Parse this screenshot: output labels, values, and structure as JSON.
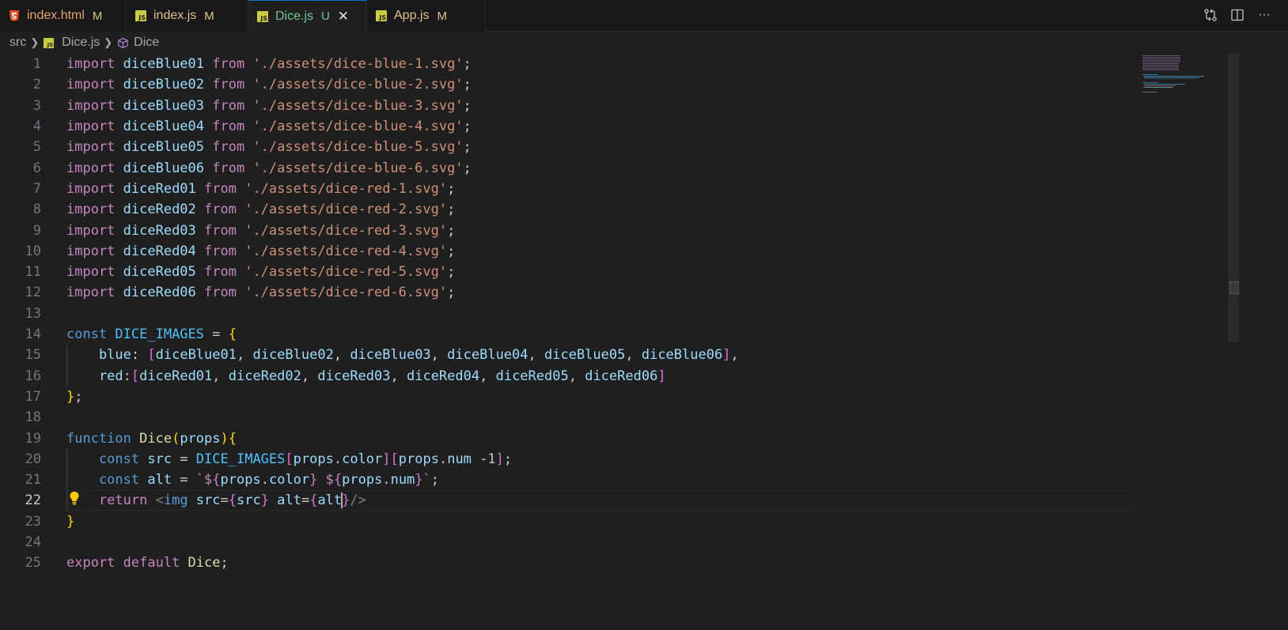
{
  "tabs": [
    {
      "label": "index.html",
      "badge": "M",
      "icon": "html5-icon"
    },
    {
      "label": "index.js",
      "badge": "M",
      "icon": "javascript-file-icon"
    },
    {
      "label": "Dice.js",
      "badge": "U",
      "icon": "javascript-file-icon",
      "active": true
    },
    {
      "label": "App.js",
      "badge": "M",
      "icon": "javascript-file-icon"
    }
  ],
  "tab_close_glyph": "✕",
  "js_icon_text": "JS",
  "actions": [
    "compare-changes-icon",
    "split-editor-icon",
    "more-actions-icon"
  ],
  "more_glyph": "···",
  "breadcrumb": {
    "folder": "src",
    "file": "Dice.js",
    "symbol": "Dice"
  },
  "colors": {
    "accent": "#0078d4",
    "modified": "#e2c08d",
    "untracked": "#73c991",
    "editor_bg": "#1f1f1f"
  },
  "editor": {
    "current_line": 22,
    "line_numbers": [
      "1",
      "2",
      "3",
      "4",
      "5",
      "6",
      "7",
      "8",
      "9",
      "10",
      "11",
      "12",
      "13",
      "14",
      "15",
      "16",
      "17",
      "18",
      "19",
      "20",
      "21",
      "22",
      "23",
      "24",
      "25"
    ],
    "lines": [
      [
        [
          "import ",
          "kw"
        ],
        [
          "diceBlue01",
          "var"
        ],
        [
          " from ",
          "kw"
        ],
        [
          "'./assets/dice-blue-1.svg'",
          "str"
        ],
        [
          ";",
          "pun"
        ]
      ],
      [
        [
          "import ",
          "kw"
        ],
        [
          "diceBlue02",
          "var"
        ],
        [
          " from ",
          "kw"
        ],
        [
          "'./assets/dice-blue-2.svg'",
          "str"
        ],
        [
          ";",
          "pun"
        ]
      ],
      [
        [
          "import ",
          "kw"
        ],
        [
          "diceBlue03",
          "var"
        ],
        [
          " from ",
          "kw"
        ],
        [
          "'./assets/dice-blue-3.svg'",
          "str"
        ],
        [
          ";",
          "pun"
        ]
      ],
      [
        [
          "import ",
          "kw"
        ],
        [
          "diceBlue04",
          "var"
        ],
        [
          " from ",
          "kw"
        ],
        [
          "'./assets/dice-blue-4.svg'",
          "str"
        ],
        [
          ";",
          "pun"
        ]
      ],
      [
        [
          "import ",
          "kw"
        ],
        [
          "diceBlue05",
          "var"
        ],
        [
          " from ",
          "kw"
        ],
        [
          "'./assets/dice-blue-5.svg'",
          "str"
        ],
        [
          ";",
          "pun"
        ]
      ],
      [
        [
          "import ",
          "kw"
        ],
        [
          "diceBlue06",
          "var"
        ],
        [
          " from ",
          "kw"
        ],
        [
          "'./assets/dice-blue-6.svg'",
          "str"
        ],
        [
          ";",
          "pun"
        ]
      ],
      [
        [
          "import ",
          "kw"
        ],
        [
          "diceRed01",
          "var"
        ],
        [
          " from ",
          "kw"
        ],
        [
          "'./assets/dice-red-1.svg'",
          "str"
        ],
        [
          ";",
          "pun"
        ]
      ],
      [
        [
          "import ",
          "kw"
        ],
        [
          "diceRed02",
          "var"
        ],
        [
          " from ",
          "kw"
        ],
        [
          "'./assets/dice-red-2.svg'",
          "str"
        ],
        [
          ";",
          "pun"
        ]
      ],
      [
        [
          "import ",
          "kw"
        ],
        [
          "diceRed03",
          "var"
        ],
        [
          " from ",
          "kw"
        ],
        [
          "'./assets/dice-red-3.svg'",
          "str"
        ],
        [
          ";",
          "pun"
        ]
      ],
      [
        [
          "import ",
          "kw"
        ],
        [
          "diceRed04",
          "var"
        ],
        [
          " from ",
          "kw"
        ],
        [
          "'./assets/dice-red-4.svg'",
          "str"
        ],
        [
          ";",
          "pun"
        ]
      ],
      [
        [
          "import ",
          "kw"
        ],
        [
          "diceRed05",
          "var"
        ],
        [
          " from ",
          "kw"
        ],
        [
          "'./assets/dice-red-5.svg'",
          "str"
        ],
        [
          ";",
          "pun"
        ]
      ],
      [
        [
          "import ",
          "kw"
        ],
        [
          "diceRed06",
          "var"
        ],
        [
          " from ",
          "kw"
        ],
        [
          "'./assets/dice-red-6.svg'",
          "str"
        ],
        [
          ";",
          "pun"
        ]
      ],
      [],
      [
        [
          "const ",
          "st"
        ],
        [
          "DICE_IMAGES",
          "con"
        ],
        [
          " = ",
          "pun"
        ],
        [
          "{",
          "br1"
        ]
      ],
      [
        [
          "    blue",
          "var"
        ],
        [
          ": ",
          "pun"
        ],
        [
          "[",
          "br2"
        ],
        [
          "diceBlue01",
          "var"
        ],
        [
          ", ",
          "pun"
        ],
        [
          "diceBlue02",
          "var"
        ],
        [
          ", ",
          "pun"
        ],
        [
          "diceBlue03",
          "var"
        ],
        [
          ", ",
          "pun"
        ],
        [
          "diceBlue04",
          "var"
        ],
        [
          ", ",
          "pun"
        ],
        [
          "diceBlue05",
          "var"
        ],
        [
          ", ",
          "pun"
        ],
        [
          "diceBlue06",
          "var"
        ],
        [
          "]",
          "br2"
        ],
        [
          ",",
          "pun"
        ]
      ],
      [
        [
          "    red",
          "var"
        ],
        [
          ":",
          "pun"
        ],
        [
          "[",
          "br2"
        ],
        [
          "diceRed01",
          "var"
        ],
        [
          ", ",
          "pun"
        ],
        [
          "diceRed02",
          "var"
        ],
        [
          ", ",
          "pun"
        ],
        [
          "diceRed03",
          "var"
        ],
        [
          ", ",
          "pun"
        ],
        [
          "diceRed04",
          "var"
        ],
        [
          ", ",
          "pun"
        ],
        [
          "diceRed05",
          "var"
        ],
        [
          ", ",
          "pun"
        ],
        [
          "diceRed06",
          "var"
        ],
        [
          "]",
          "br2"
        ]
      ],
      [
        [
          "}",
          "br1"
        ],
        [
          ";",
          "pun"
        ]
      ],
      [],
      [
        [
          "function ",
          "st"
        ],
        [
          "Dice",
          "fn"
        ],
        [
          "(",
          "br1"
        ],
        [
          "props",
          "var"
        ],
        [
          ")",
          "br1"
        ],
        [
          "{",
          "br1"
        ]
      ],
      [
        [
          "    const ",
          "st"
        ],
        [
          "src",
          "var"
        ],
        [
          " = ",
          "pun"
        ],
        [
          "DICE_IMAGES",
          "con"
        ],
        [
          "[",
          "br2"
        ],
        [
          "props",
          "var"
        ],
        [
          ".",
          "pun"
        ],
        [
          "color",
          "var"
        ],
        [
          "]",
          "br2"
        ],
        [
          "[",
          "br2"
        ],
        [
          "props",
          "var"
        ],
        [
          ".",
          "pun"
        ],
        [
          "num",
          "var"
        ],
        [
          " -",
          "pun"
        ],
        [
          "1",
          "num"
        ],
        [
          "]",
          "br2"
        ],
        [
          ";",
          "pun"
        ]
      ],
      [
        [
          "    const ",
          "st"
        ],
        [
          "alt",
          "var"
        ],
        [
          " = ",
          "pun"
        ],
        [
          "`",
          "str"
        ],
        [
          "${",
          "kw"
        ],
        [
          "props",
          "var"
        ],
        [
          ".",
          "pun"
        ],
        [
          "color",
          "var"
        ],
        [
          "}",
          "kw"
        ],
        [
          " ",
          "str"
        ],
        [
          "${",
          "kw"
        ],
        [
          "props",
          "var"
        ],
        [
          ".",
          "pun"
        ],
        [
          "num",
          "var"
        ],
        [
          "}",
          "kw"
        ],
        [
          "`",
          "str"
        ],
        [
          ";",
          "pun"
        ]
      ],
      [
        [
          "    return ",
          "kw"
        ],
        [
          "<",
          "angle"
        ],
        [
          "img ",
          "tag"
        ],
        [
          "src",
          "attr"
        ],
        [
          "=",
          "pun"
        ],
        [
          "{",
          "br2"
        ],
        [
          "src",
          "var"
        ],
        [
          "}",
          "br2"
        ],
        [
          " alt",
          "attr"
        ],
        [
          "=",
          "pun"
        ],
        [
          "{",
          "br2"
        ],
        [
          "alt",
          "var"
        ],
        [
          "|",
          "cursor"
        ],
        [
          "}",
          "br2"
        ],
        [
          "/>",
          "angle"
        ]
      ],
      [
        [
          "}",
          "br1"
        ]
      ],
      [],
      [
        [
          "export ",
          "kw"
        ],
        [
          "default ",
          "kw"
        ],
        [
          "Dice",
          "fn"
        ],
        [
          ";",
          "pun"
        ]
      ]
    ]
  }
}
